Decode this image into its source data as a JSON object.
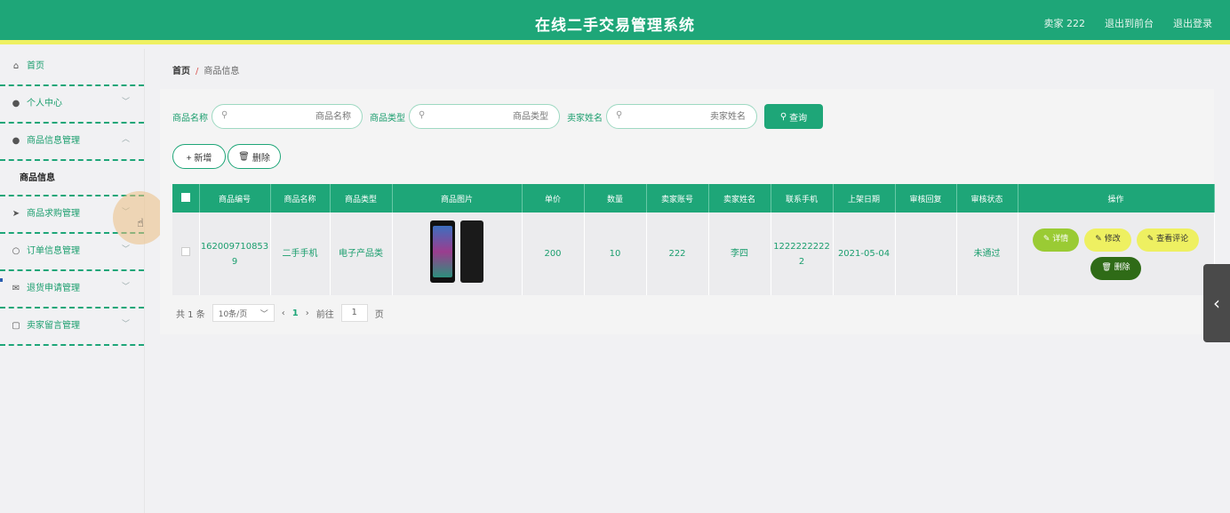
{
  "header": {
    "title": "在线二手交易管理系统",
    "user_label": "卖家 222",
    "to_front_label": "退出到前台",
    "logout_label": "退出登录"
  },
  "sidebar": {
    "items": [
      {
        "label": "首页",
        "icon": "home-icon"
      },
      {
        "label": "个人中心",
        "icon": "user-icon"
      },
      {
        "label": "商品信息管理",
        "icon": "user-icon"
      },
      {
        "label": "商品求购管理",
        "icon": "send-icon"
      },
      {
        "label": "订单信息管理",
        "icon": "circle-icon"
      },
      {
        "label": "退货申请管理",
        "icon": "mail-icon"
      },
      {
        "label": "卖家留言管理",
        "icon": "frame-icon"
      }
    ],
    "submenu_label": "商品信息"
  },
  "breadcrumb": {
    "home": "首页",
    "current": "商品信息"
  },
  "search": {
    "fields": [
      {
        "label": "商品名称",
        "placeholder": "商品名称"
      },
      {
        "label": "商品类型",
        "placeholder": "商品类型"
      },
      {
        "label": "卖家姓名",
        "placeholder": "卖家姓名"
      }
    ],
    "query_label": "查询"
  },
  "actions": {
    "add_label": "+ 新增",
    "delete_label": "删除"
  },
  "table": {
    "columns": [
      "商品编号",
      "商品名称",
      "商品类型",
      "商品图片",
      "单价",
      "数量",
      "卖家账号",
      "卖家姓名",
      "联系手机",
      "上架日期",
      "审核回复",
      "审核状态",
      "操作"
    ],
    "rows": [
      {
        "id": "1620097108539",
        "name": "二手手机",
        "type": "电子产品类",
        "price": "200",
        "qty": "10",
        "account": "222",
        "seller": "李四",
        "phone": "12222222222",
        "date": "2021-05-04",
        "reply": "",
        "status": "未通过"
      }
    ],
    "ops": {
      "detail": "详情",
      "edit": "修改",
      "review": "查看评论",
      "delete": "删除"
    }
  },
  "pager": {
    "total": "共 1 条",
    "page_size": "10条/页",
    "current": "1",
    "goto_prefix": "前往",
    "goto_value": "1",
    "goto_suffix": "页"
  },
  "colors": {
    "primary": "#1ea678",
    "accent_yellow": "#eef061",
    "detail_green": "#9acb34",
    "delete_dark": "#2f6b17"
  }
}
